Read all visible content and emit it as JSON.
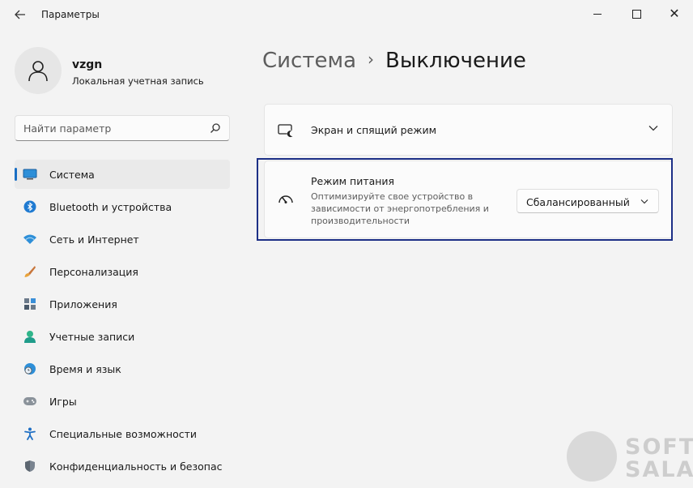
{
  "window": {
    "title": "Параметры"
  },
  "user": {
    "name": "vzgn",
    "account_type": "Локальная учетная запись"
  },
  "search": {
    "placeholder": "Найти параметр"
  },
  "sidebar": {
    "items": [
      {
        "label": "Система",
        "icon": "monitor-icon",
        "active": true
      },
      {
        "label": "Bluetooth и устройства",
        "icon": "bluetooth-icon"
      },
      {
        "label": "Сеть и Интернет",
        "icon": "wifi-icon"
      },
      {
        "label": "Персонализация",
        "icon": "brush-icon"
      },
      {
        "label": "Приложения",
        "icon": "apps-icon"
      },
      {
        "label": "Учетные записи",
        "icon": "accounts-icon"
      },
      {
        "label": "Время и язык",
        "icon": "clock-globe-icon"
      },
      {
        "label": "Игры",
        "icon": "gamepad-icon"
      },
      {
        "label": "Специальные возможности",
        "icon": "accessibility-icon"
      },
      {
        "label": "Конфиденциальность и безопас",
        "icon": "shield-icon"
      }
    ]
  },
  "breadcrumb": {
    "parent": "Система",
    "separator": "›",
    "current": "Выключение"
  },
  "cards": {
    "screen_sleep": {
      "label": "Экран и спящий режим"
    },
    "power_mode": {
      "title": "Режим питания",
      "description": "Оптимизируйте свое устройство в зависимости от энергопотребления и производительности",
      "selected": "Сбалансированный"
    }
  },
  "watermark": {
    "line1": "SOFT",
    "line2": "SALAD"
  },
  "colors": {
    "accent": "#1a6fc4",
    "highlight_border": "#1c2f86",
    "background": "#f3f3f3",
    "card": "#fbfbfb"
  }
}
